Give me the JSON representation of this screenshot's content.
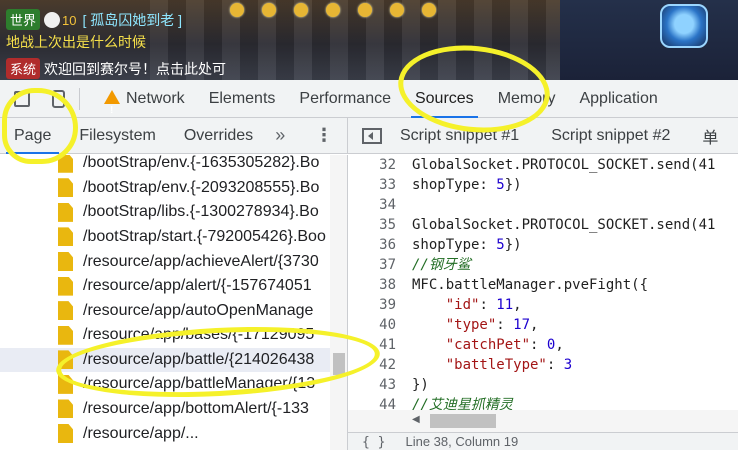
{
  "game": {
    "chat": [
      {
        "channel": "世界",
        "level": "10",
        "name": "[ 孤岛囚她到老 ]",
        "text": "地战上次出是什么时候"
      },
      {
        "channel": "系统",
        "text": "欢迎回到赛尔号！点击此处可"
      }
    ]
  },
  "devtools": {
    "tabs": [
      {
        "label": "Network"
      },
      {
        "label": "Elements"
      },
      {
        "label": "Performance"
      },
      {
        "label": "Sources"
      },
      {
        "label": "Memory"
      },
      {
        "label": "Application"
      }
    ],
    "active_tab": "Sources",
    "left_subtabs": [
      {
        "label": "Page"
      },
      {
        "label": "Filesystem"
      },
      {
        "label": "Overrides"
      }
    ],
    "more_label": "»",
    "kebab_label": "⋮",
    "right_subtabs": [
      {
        "label": "Script snippet #1"
      },
      {
        "label": "Script snippet #2"
      },
      {
        "label": "单"
      }
    ],
    "files": [
      "/bootStrap/env.{-1635305282}.Bo",
      "/bootStrap/env.{-2093208555}.Bo",
      "/bootStrap/libs.{-1300278934}.Bo",
      "/bootStrap/start.{-792005426}.Boo",
      "/resource/app/achieveAlert/{3730",
      "/resource/app/alert/{-157674051",
      "/resource/app/autoOpenManage",
      "/resource/app/bases/{-17129095",
      "/resource/app/battle/{214026438",
      "/resource/app/battleManager/{13",
      "/resource/app/bottomAlert/{-133",
      "/resource/app/..."
    ],
    "selected_file_index": 8,
    "code": {
      "l32": "32",
      "c32": "GlobalSocket.PROTOCOL_SOCKET.send(41",
      "l33": "33",
      "c33a": "shopType: ",
      "c33n": "5",
      "c33b": "})",
      "l34": "34",
      "l35": "35",
      "c35": "GlobalSocket.PROTOCOL_SOCKET.send(41",
      "l36": "36",
      "c36a": "shopType: ",
      "c36n": "5",
      "c36b": "})",
      "l37": "37",
      "c37": "//钢牙鲨",
      "l38": "38",
      "c38": "MFC.battleManager.pveFight({",
      "l39": "39",
      "c39k": "\"id\"",
      "c39a": ": ",
      "c39n": "11",
      "c39b": ",",
      "l40": "40",
      "c40k": "\"type\"",
      "c40a": ": ",
      "c40n": "17",
      "c40b": ",",
      "l41": "41",
      "c41k": "\"catchPet\"",
      "c41a": ": ",
      "c41n": "0",
      "c41b": ",",
      "l42": "42",
      "c42k": "\"battleType\"",
      "c42a": ": ",
      "c42n": "3",
      "l43": "43",
      "c43": "})",
      "l44": "44",
      "c44": "//艾迪星抓精灵",
      "l45": "45"
    },
    "status": "Line 38, Column 19",
    "braces_label": "{ }"
  },
  "colors": {
    "accent": "#1a73e8",
    "annotation": "#f5f12a",
    "file_icon": "#e9b70f"
  }
}
